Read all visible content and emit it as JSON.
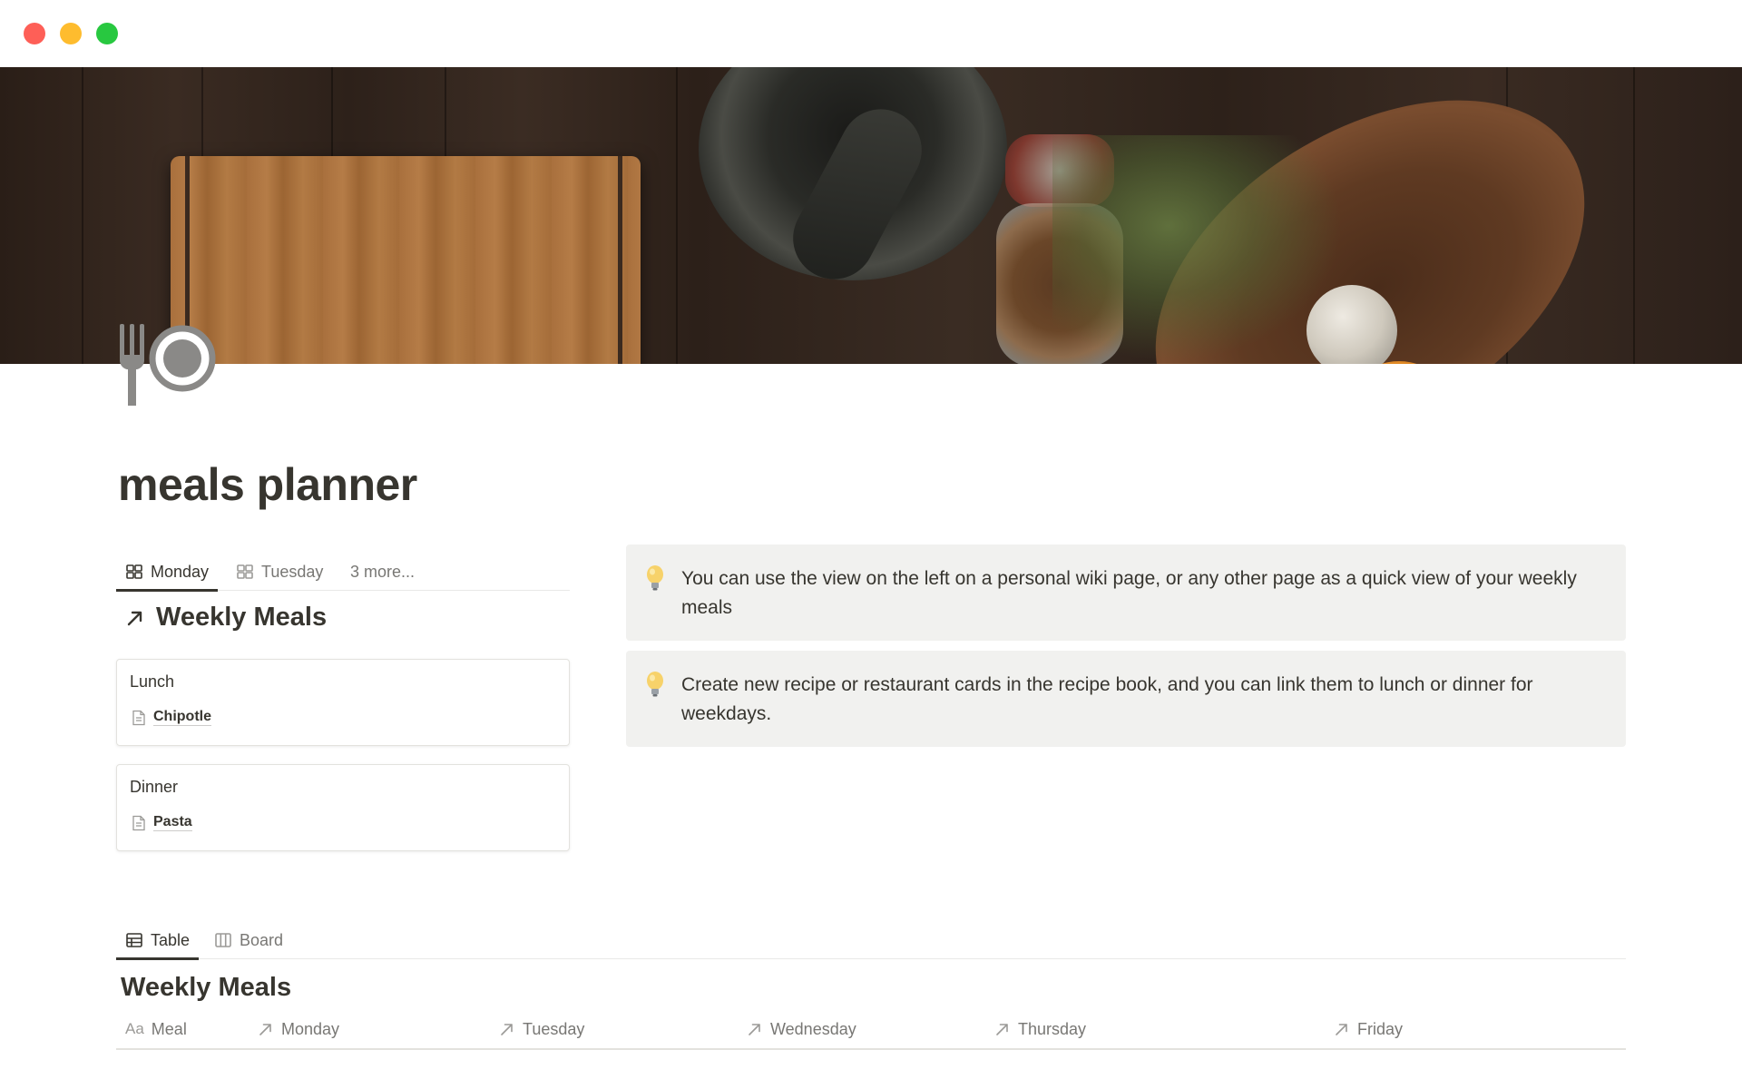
{
  "window": {
    "controls": [
      "close",
      "minimize",
      "maximize"
    ]
  },
  "page": {
    "icon": "fork-and-plate-icon",
    "title": "meals planner"
  },
  "linked_view": {
    "tabs": [
      {
        "label": "Monday",
        "icon": "gallery-icon",
        "active": true
      },
      {
        "label": "Tuesday",
        "icon": "gallery-icon",
        "active": false
      },
      {
        "label": "3 more...",
        "active": false
      }
    ],
    "title": "Weekly Meals",
    "cards": [
      {
        "title": "Lunch",
        "link": "Chipotle"
      },
      {
        "title": "Dinner",
        "link": "Pasta"
      }
    ]
  },
  "callouts": [
    {
      "icon": "lightbulb-icon",
      "text": "You can use the view on the left on a personal wiki page, or any other page as a quick view of your weekly meals"
    },
    {
      "icon": "lightbulb-icon",
      "text": "Create new recipe or restaurant cards in the recipe book, and you can link them to lunch or dinner for weekdays."
    }
  ],
  "database": {
    "tabs": [
      {
        "label": "Table",
        "icon": "table-icon",
        "active": true
      },
      {
        "label": "Board",
        "icon": "board-icon",
        "active": false
      }
    ],
    "title": "Weekly Meals",
    "columns": [
      {
        "prefix": "Aa",
        "label": "Meal"
      },
      {
        "label": "Monday",
        "icon": "relation-arrow-icon"
      },
      {
        "label": "Tuesday",
        "icon": "relation-arrow-icon"
      },
      {
        "label": "Wednesday",
        "icon": "relation-arrow-icon"
      },
      {
        "label": "Thursday",
        "icon": "relation-arrow-icon"
      },
      {
        "label": "Friday",
        "icon": "relation-arrow-icon"
      }
    ]
  }
}
